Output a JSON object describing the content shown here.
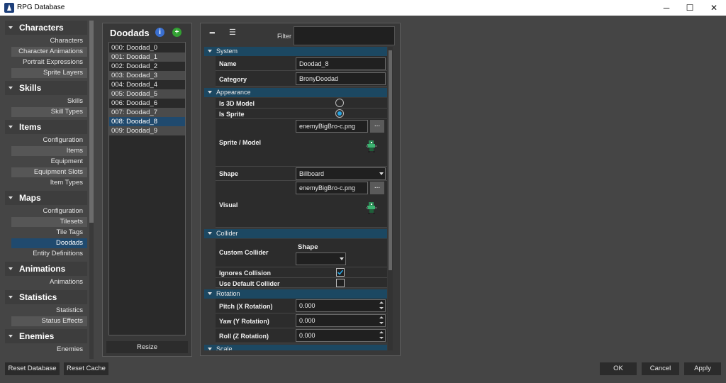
{
  "window": {
    "title": "RPG Database",
    "minimize": "─",
    "maximize": "☐",
    "close": "✕"
  },
  "sidebar": {
    "categories": [
      {
        "label": "Characters",
        "items": [
          "Characters",
          "Character Animations",
          "Portrait Expressions",
          "Sprite Layers"
        ]
      },
      {
        "label": "Skills",
        "items": [
          "Skills",
          "Skill Types"
        ]
      },
      {
        "label": "Items",
        "items": [
          "Configuration",
          "Items",
          "Equipment",
          "Equipment Slots",
          "Item Types"
        ]
      },
      {
        "label": "Maps",
        "items": [
          "Configuration",
          "Tilesets",
          "Tile Tags",
          "Doodads",
          "Entity Definitions"
        ]
      },
      {
        "label": "Animations",
        "items": [
          "Animations"
        ]
      },
      {
        "label": "Statistics",
        "items": [
          "Statistics",
          "Status Effects"
        ]
      },
      {
        "label": "Enemies",
        "items": [
          "Enemies"
        ]
      }
    ],
    "selected": "Doodads"
  },
  "doodads": {
    "title": "Doodads",
    "info_icon": "i",
    "add_icon": "+",
    "items": [
      "000: Doodad_0",
      "001: Doodad_1",
      "002: Doodad_2",
      "003: Doodad_3",
      "004: Doodad_4",
      "005: Doodad_5",
      "006: Doodad_6",
      "007: Doodad_7",
      "008: Doodad_8",
      "009: Doodad_9"
    ],
    "selected_index": 8,
    "resize_label": "Resize"
  },
  "properties": {
    "toolbar": {
      "collapse_icon": "━",
      "expand_icon": "☰",
      "filter_label": "Filter",
      "filter_value": ""
    },
    "sections": {
      "system": "System",
      "appearance": "Appearance",
      "collider": "Collider",
      "rotation": "Rotation",
      "scale": "Scale"
    },
    "name_label": "Name",
    "name_value": "Doodad_8",
    "category_label": "Category",
    "category_value": "BronyDoodad",
    "is3d_label": "Is 3D Model",
    "is3d_value": false,
    "issprite_label": "Is Sprite",
    "issprite_value": true,
    "sprite_label": "Sprite / Model",
    "sprite_value": "enemyBigBro-c.png",
    "browse_label": "...",
    "shape_label": "Shape",
    "shape_value": "Billboard",
    "visual_label": "Visual",
    "visual_value": "enemyBigBro-c.png",
    "custom_collider_label": "Custom Collider",
    "collider_shape_label": "Shape",
    "collider_shape_value": "",
    "ignores_collision_label": "Ignores Collision",
    "ignores_collision_value": true,
    "use_default_collider_label": "Use Default Collider",
    "use_default_collider_value": false,
    "pitch_label": "Pitch (X Rotation)",
    "pitch_value": "0.000",
    "yaw_label": "Yaw (Y Rotation)",
    "yaw_value": "0.000",
    "roll_label": "Roll (Z Rotation)",
    "roll_value": "0.000"
  },
  "footer": {
    "reset_database": "Reset Database",
    "reset_cache": "Reset Cache",
    "ok": "OK",
    "cancel": "Cancel",
    "apply": "Apply"
  },
  "colors": {
    "accent": "#204a6e",
    "section_header": "#1c4862",
    "radio_on": "#27a3e0",
    "info_icon": "#3a6fd0",
    "add_icon": "#33a133"
  }
}
